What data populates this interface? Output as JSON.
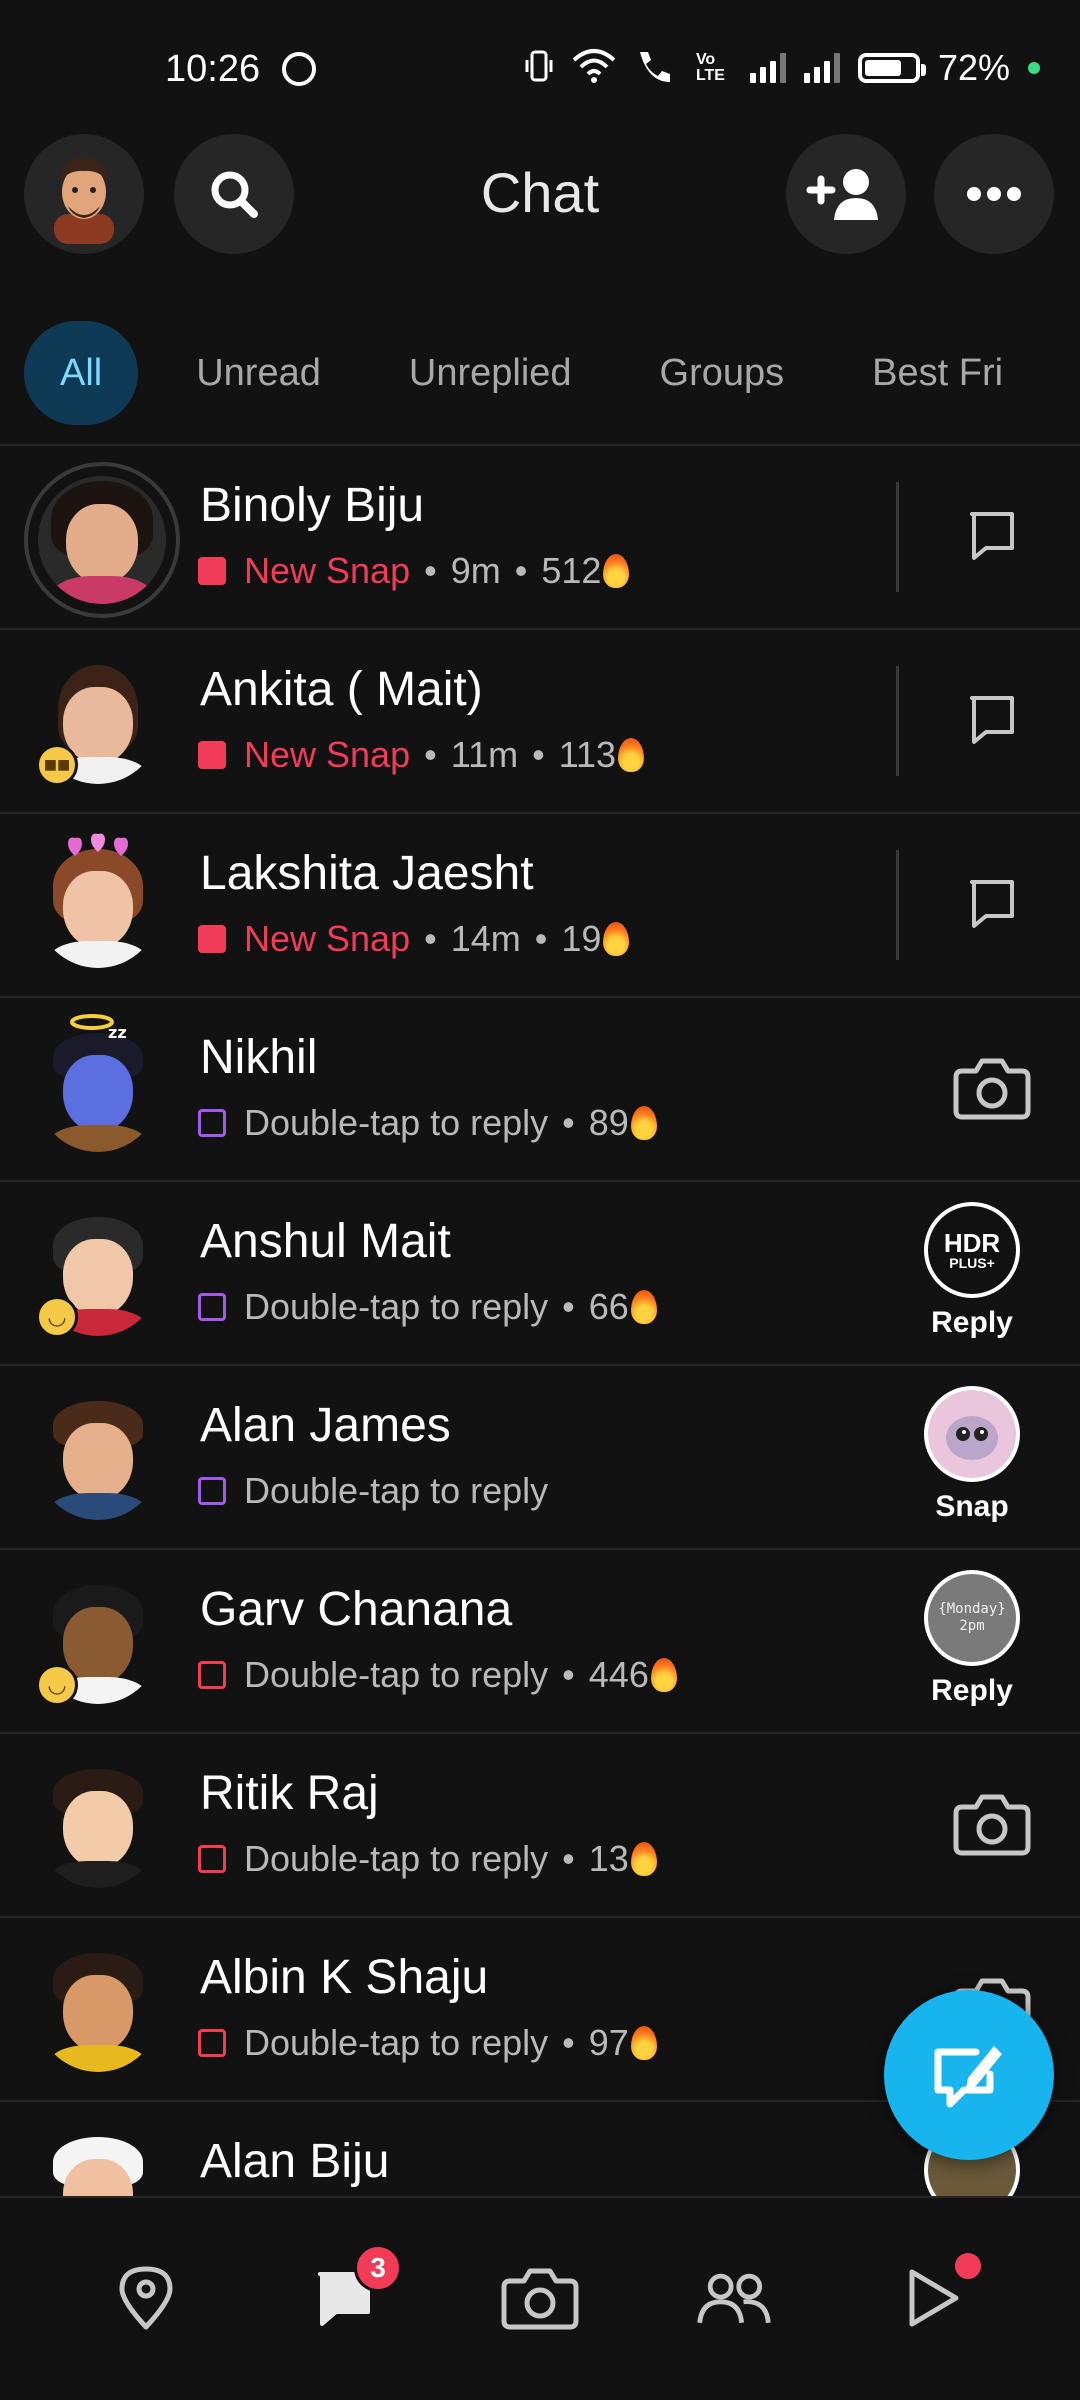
{
  "status_bar": {
    "time": "10:26",
    "volte_label": "Vo LTE",
    "battery_percent": "72%",
    "battery_level": 0.72
  },
  "header": {
    "title": "Chat"
  },
  "tabs": [
    {
      "label": "All",
      "active": true
    },
    {
      "label": "Unread",
      "active": false
    },
    {
      "label": "Unreplied",
      "active": false
    },
    {
      "label": "Groups",
      "active": false
    },
    {
      "label": "Best Fri",
      "active": false
    }
  ],
  "chats": [
    {
      "name": "Binoly Biju",
      "status": "New Snap",
      "time": "9m",
      "streak": "512",
      "action": "chat-icon"
    },
    {
      "name": "Ankita ( Mait)",
      "status": "New Snap",
      "time": "11m",
      "streak": "113",
      "action": "chat-icon"
    },
    {
      "name": "Lakshita Jaesht",
      "status": "New Snap",
      "time": "14m",
      "streak": "19",
      "action": "chat-icon"
    },
    {
      "name": "Nikhil",
      "status": "Double-tap to reply",
      "streak": "89",
      "action": "camera-icon"
    },
    {
      "name": "Anshul Mait",
      "status": "Double-tap to reply",
      "streak": "66",
      "action": "story",
      "action_label": "Reply",
      "story_text_1": "HDR",
      "story_text_2": "PLUS+"
    },
    {
      "name": "Alan James",
      "status": "Double-tap to reply",
      "action": "story",
      "action_label": "Snap"
    },
    {
      "name": "Garv Chanana",
      "status": "Double-tap to reply",
      "streak": "446",
      "action": "story",
      "action_label": "Reply",
      "story_text_1": "{Monday}",
      "story_text_2": "2pm"
    },
    {
      "name": "Ritik Raj",
      "status": "Double-tap to reply",
      "streak": "13",
      "action": "camera-icon"
    },
    {
      "name": "Albin K Shaju",
      "status": "Double-tap to reply",
      "streak": "97",
      "action": "camera-icon"
    },
    {
      "name": "Alan Biju",
      "action": "story"
    }
  ],
  "bottom_nav": {
    "chat_badge": "3",
    "items": [
      "map-icon",
      "chat-icon",
      "camera-icon",
      "friends-icon",
      "spotlight-play-icon"
    ]
  },
  "colors": {
    "background": "#121212",
    "accent_blue": "#17b4ee",
    "new_snap_red": "#f23c57",
    "chat_purple": "#a05ce6",
    "tab_active_bg": "#0f3a55"
  }
}
